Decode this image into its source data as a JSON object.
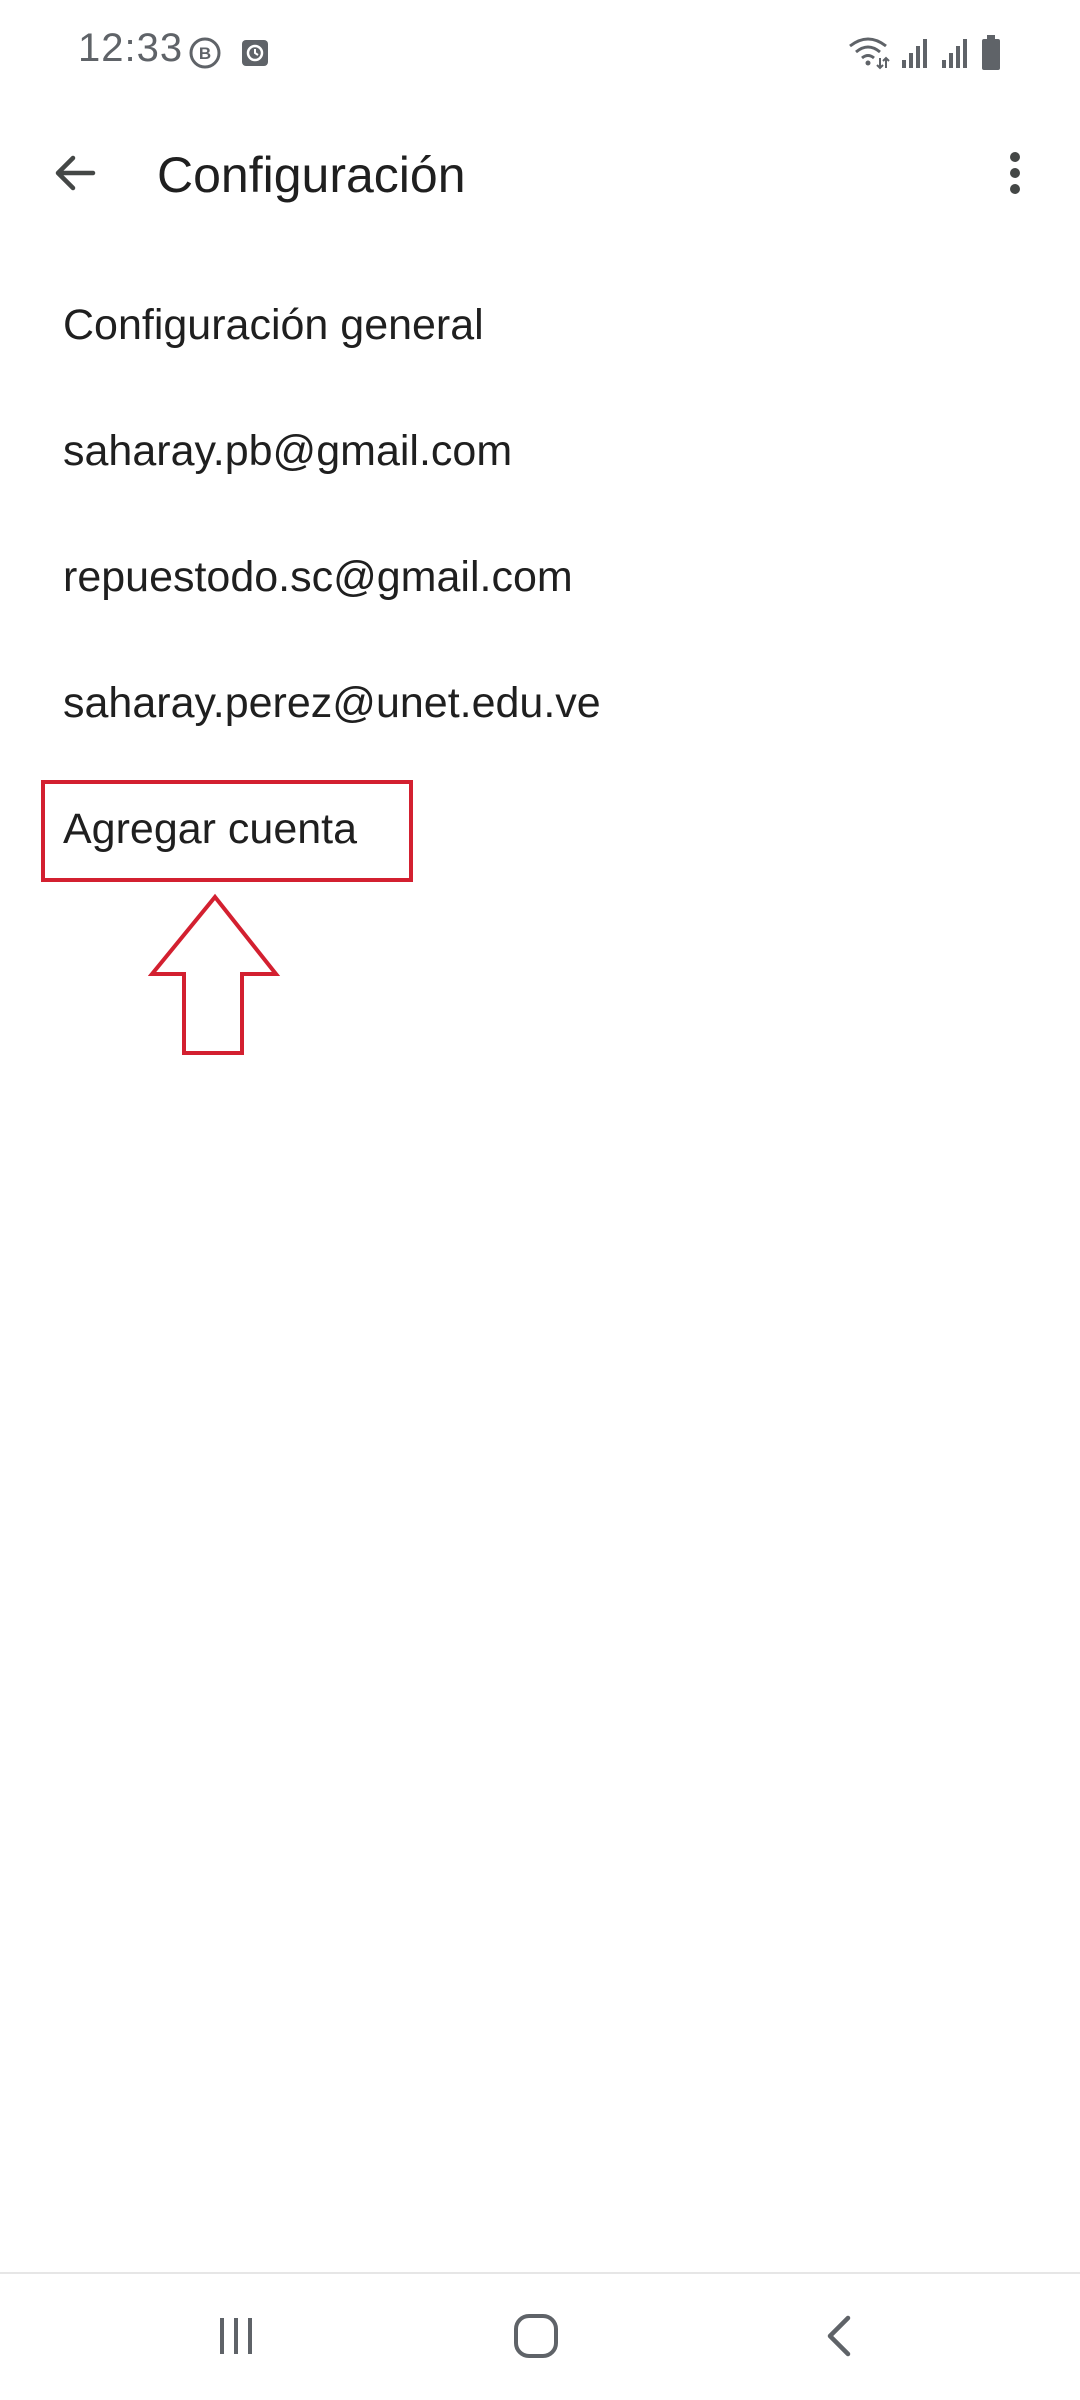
{
  "status_bar": {
    "time": "12:33",
    "left_icons": [
      "bixby-icon",
      "clock-app-icon"
    ],
    "right_icons": [
      "wifi-icon",
      "signal-icon",
      "signal-icon",
      "battery-icon"
    ]
  },
  "app_bar": {
    "title": "Configuración",
    "back_icon": "arrow-back-icon",
    "menu_icon": "more-vert-icon"
  },
  "settings": {
    "items": [
      {
        "label": "Configuración general"
      },
      {
        "label": "saharay.pb@gmail.com"
      },
      {
        "label": "repuestodo.sc@gmail.com"
      },
      {
        "label": "saharay.perez@unet.edu.ve"
      },
      {
        "label": "Agregar cuenta"
      }
    ]
  },
  "annotation": {
    "color": "#d32030",
    "target": "Agregar cuenta"
  },
  "nav_bar": {
    "buttons": [
      "recents-icon",
      "home-icon",
      "back-icon"
    ]
  },
  "colors": {
    "text_primary": "#1f1f1f",
    "status_text": "#5f6368",
    "annotation_red": "#d32030"
  }
}
